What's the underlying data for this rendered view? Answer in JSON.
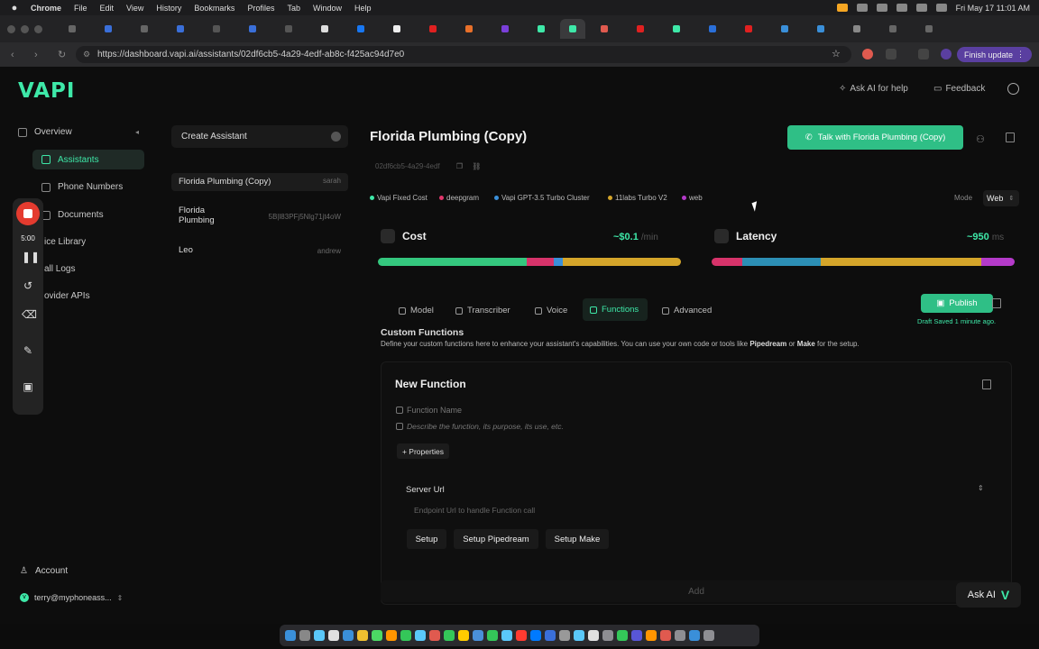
{
  "menubar": {
    "app": "Chrome",
    "menus": [
      "File",
      "Edit",
      "View",
      "History",
      "Bookmarks",
      "Profiles",
      "Tab",
      "Window",
      "Help"
    ],
    "clock": "Fri May 17  11:01 AM"
  },
  "browser": {
    "url": "https://dashboard.vapi.ai/assistants/02df6cb5-4a29-4edf-ab8c-f425ac94d7e0",
    "finish_update": "Finish update"
  },
  "header": {
    "logo": "VAPI",
    "ask_ai_help": "Ask AI for help",
    "feedback": "Feedback"
  },
  "sidebar": {
    "overview": "Overview",
    "items": [
      "Assistants",
      "Phone Numbers",
      "Documents",
      "ice Library",
      "all Logs",
      "ovider APIs"
    ],
    "account": "Account",
    "user": "terry@myphoneass..."
  },
  "recorder": {
    "time": "5:00"
  },
  "assistants": {
    "create_label": "Create Assistant",
    "list": [
      {
        "name": "Florida Plumbing (Copy)",
        "sub": "sarah"
      },
      {
        "name": "Florida Plumbing",
        "sub": "5B|l83PFj5Nlg71jt4oW"
      },
      {
        "name": "Leo",
        "sub": "andrew"
      }
    ]
  },
  "main": {
    "title": "Florida Plumbing (Copy)",
    "id": "02df6cb5-4a29-4edf",
    "talk_button": "Talk with Florida Plumbing (Copy)",
    "tags": [
      {
        "label": "Vapi Fixed Cost",
        "color": "#3ee8a8"
      },
      {
        "label": "deepgram",
        "color": "#e0366b"
      },
      {
        "label": "Vapi GPT-3.5 Turbo Cluster",
        "color": "#3a8fd9"
      },
      {
        "label": "11labs Turbo V2",
        "color": "#d4a52a"
      },
      {
        "label": "web",
        "color": "#b43ac9"
      }
    ],
    "mode_label": "Mode",
    "mode_value": "Web",
    "cost": {
      "label": "Cost",
      "value": "~$0.1",
      "unit": "/min"
    },
    "latency": {
      "label": "Latency",
      "value": "~950",
      "unit": "ms"
    },
    "cost_bar": [
      {
        "color": "#34c77e",
        "share": 0.49
      },
      {
        "color": "#d7336a",
        "share": 0.09
      },
      {
        "color": "#3a8fd9",
        "share": 0.03
      },
      {
        "color": "#d4a52a",
        "share": 0.39
      }
    ],
    "latency_bar": [
      {
        "color": "#d7336a",
        "share": 0.1
      },
      {
        "color": "#2c8fb5",
        "share": 0.26
      },
      {
        "color": "#d4a52a",
        "share": 0.53
      },
      {
        "color": "#b43ac9",
        "share": 0.11
      }
    ],
    "tabs": [
      "Model",
      "Transcriber",
      "Voice",
      "Functions",
      "Advanced"
    ],
    "publish": "Publish",
    "draft_status": "Draft Saved 1 minute ago."
  },
  "functions": {
    "section_title": "Custom Functions",
    "description_pre": "Define your custom functions here to enhance your assistant's capabilities. You can use your own code or tools like ",
    "pipedream": "Pipedream",
    "or": " or ",
    "make": "Make",
    "description_post": " for the setup.",
    "new_function": "New Function",
    "name_placeholder": "Function Name",
    "desc_placeholder": "Describe the function, its purpose, its use, etc.",
    "properties": "+ Properties",
    "server_url_label": "Server Url",
    "server_url_placeholder": "Endpoint Url to handle Function call",
    "setup": "Setup",
    "setup_pipedream": "Setup Pipedream",
    "setup_make": "Setup Make",
    "add": "Add",
    "ask_ai": "Ask AI"
  }
}
